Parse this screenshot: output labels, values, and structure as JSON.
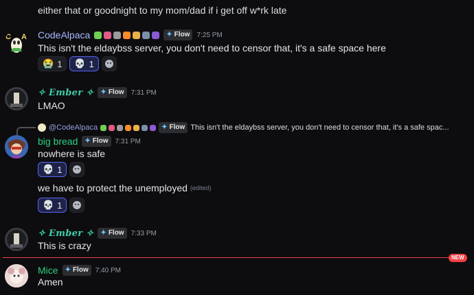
{
  "top_message": "either that or goodnight to my mom/dad if i get off w*rk late",
  "messages": [
    {
      "user": "CodeAlpaca",
      "flow": "Flow",
      "time": "7:25 PM",
      "text": "This isn't the eldaybss server, you don't need to censor that, it's a safe space here",
      "reactions": [
        {
          "emoji": "😭",
          "count": "1"
        },
        {
          "emoji": "💀",
          "count": "1"
        }
      ]
    },
    {
      "user": "✧ Ember ✧",
      "flow": "Flow",
      "time": "7:31 PM",
      "text": "LMAO"
    },
    {
      "reply_user": "@CodeAlpaca",
      "reply_flow": "Flow",
      "reply_text": "This isn't the eldaybss server, you don't need to censor that, it's a safe spac...",
      "user": "big bread",
      "flow": "Flow",
      "time": "7:31 PM",
      "text": "nowhere is safe",
      "reactions": [
        {
          "emoji": "💀",
          "count": "1"
        }
      ],
      "text2": "we have to protect the unemployed",
      "edited": "(edited)",
      "reactions2": [
        {
          "emoji": "💀",
          "count": "1"
        }
      ]
    },
    {
      "user": "✧ Ember ✧",
      "flow": "Flow",
      "time": "7:33 PM",
      "text": "This is crazy"
    },
    {
      "user": "Mice",
      "flow": "Flow",
      "time": "7:40 PM",
      "text": "Amen"
    }
  ],
  "new_label": "NEW",
  "colors": {
    "background": "#0d0d10",
    "active_reaction_border": "#5865f2",
    "new_divider": "#f23f43",
    "ember_name": "#3fd0a7",
    "codealpaca_name": "#a9b9ff",
    "green_name": "#2bd17f"
  }
}
